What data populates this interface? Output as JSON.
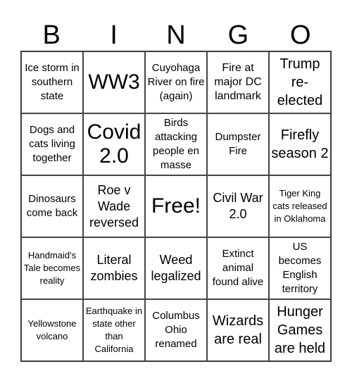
{
  "header": [
    "B",
    "I",
    "N",
    "G",
    "O"
  ],
  "cells": [
    [
      "Ice storm in southern state",
      "WW3",
      "Cuyohaga River on fire (again)",
      "Fire at major DC landmark",
      "Trump re-elected"
    ],
    [
      "Dogs and cats living together",
      "Covid 2.0",
      "Birds attacking people en masse",
      "Dumpster Fire",
      "Firefly season 2"
    ],
    [
      "Dinosaurs come back",
      "Roe v Wade reversed",
      "Free!",
      "Civil War 2.0",
      "Tiger King cats released in Oklahoma"
    ],
    [
      "Handmaid's Tale becomes reality",
      "Literal zombies",
      "Weed legalized",
      "Extinct animal found alive",
      "US becomes English territory"
    ],
    [
      "Yellowstone volcano",
      "Earthquake in state other than California",
      "Columbus Ohio renamed",
      "Wizards are real",
      "Hunger Games are held"
    ]
  ]
}
